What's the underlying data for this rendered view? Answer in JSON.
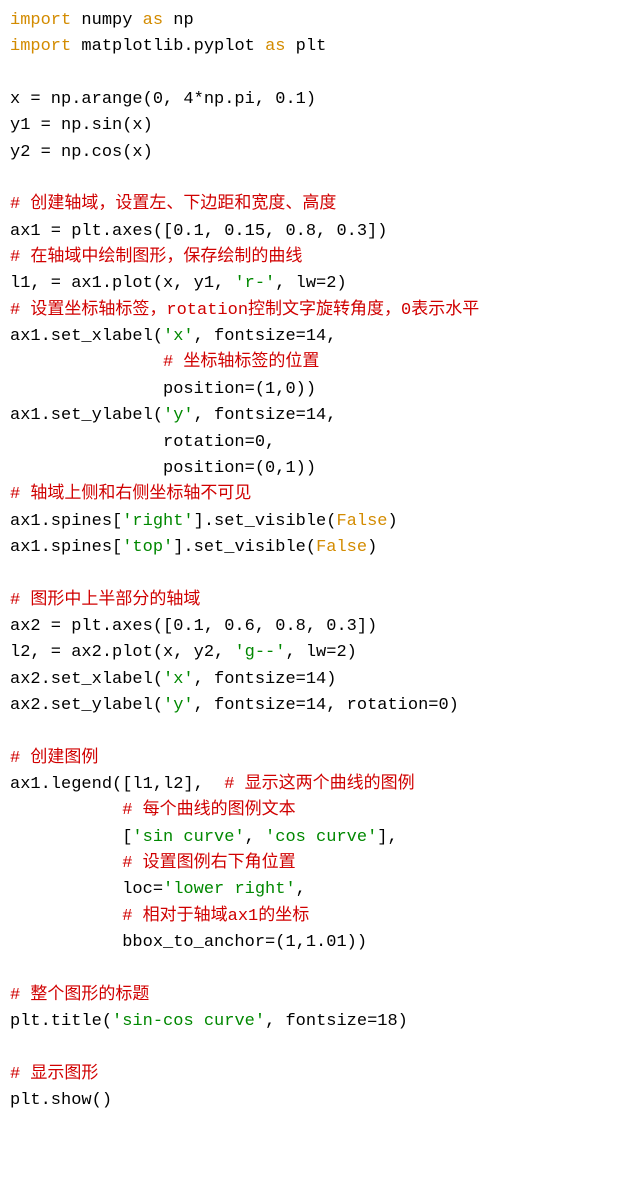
{
  "tokens": [
    {
      "cls": "kw",
      "t": "import"
    },
    {
      "t": " numpy "
    },
    {
      "cls": "kw",
      "t": "as"
    },
    {
      "t": " np\n"
    },
    {
      "cls": "kw",
      "t": "import"
    },
    {
      "t": " matplotlib.pyplot "
    },
    {
      "cls": "kw",
      "t": "as"
    },
    {
      "t": " plt\n"
    },
    {
      "t": "\n"
    },
    {
      "t": "x = np.arange(0, 4*np.pi, 0.1)\n"
    },
    {
      "t": "y1 = np.sin(x)\n"
    },
    {
      "t": "y2 = np.cos(x)\n"
    },
    {
      "t": "\n"
    },
    {
      "cls": "cm",
      "t": "# 创建轴域，设置左、下边距和宽度、高度"
    },
    {
      "t": "\n"
    },
    {
      "t": "ax1 = plt.axes([0.1, 0.15, 0.8, 0.3])\n"
    },
    {
      "cls": "cm",
      "t": "# 在轴域中绘制图形，保存绘制的曲线"
    },
    {
      "t": "\n"
    },
    {
      "t": "l1, = ax1.plot(x, y1, "
    },
    {
      "cls": "st",
      "t": "'r-'"
    },
    {
      "t": ", lw=2)\n"
    },
    {
      "cls": "cm",
      "t": "# 设置坐标轴标签，rotation控制文字旋转角度，0表示水平"
    },
    {
      "t": "\n"
    },
    {
      "t": "ax1.set_xlabel("
    },
    {
      "cls": "st",
      "t": "'x'"
    },
    {
      "t": ", fontsize=14,\n"
    },
    {
      "t": "               "
    },
    {
      "cls": "cm",
      "t": "# 坐标轴标签的位置"
    },
    {
      "t": "\n"
    },
    {
      "t": "               position=(1,0))\n"
    },
    {
      "t": "ax1.set_ylabel("
    },
    {
      "cls": "st",
      "t": "'y'"
    },
    {
      "t": ", fontsize=14,\n"
    },
    {
      "t": "               rotation=0,\n"
    },
    {
      "t": "               position=(0,1))\n"
    },
    {
      "cls": "cm",
      "t": "# 轴域上侧和右侧坐标轴不可见"
    },
    {
      "t": "\n"
    },
    {
      "t": "ax1.spines["
    },
    {
      "cls": "st",
      "t": "'right'"
    },
    {
      "t": "].set_visible("
    },
    {
      "cls": "bl",
      "t": "False"
    },
    {
      "t": ")\n"
    },
    {
      "t": "ax1.spines["
    },
    {
      "cls": "st",
      "t": "'top'"
    },
    {
      "t": "].set_visible("
    },
    {
      "cls": "bl",
      "t": "False"
    },
    {
      "t": ")\n"
    },
    {
      "t": "\n"
    },
    {
      "cls": "cm",
      "t": "# 图形中上半部分的轴域"
    },
    {
      "t": "\n"
    },
    {
      "t": "ax2 = plt.axes([0.1, 0.6, 0.8, 0.3])\n"
    },
    {
      "t": "l2, = ax2.plot(x, y2, "
    },
    {
      "cls": "st",
      "t": "'g--'"
    },
    {
      "t": ", lw=2)\n"
    },
    {
      "t": "ax2.set_xlabel("
    },
    {
      "cls": "st",
      "t": "'x'"
    },
    {
      "t": ", fontsize=14)\n"
    },
    {
      "t": "ax2.set_ylabel("
    },
    {
      "cls": "st",
      "t": "'y'"
    },
    {
      "t": ", fontsize=14, rotation=0)\n"
    },
    {
      "t": "\n"
    },
    {
      "cls": "cm",
      "t": "# 创建图例"
    },
    {
      "t": "\n"
    },
    {
      "t": "ax1.legend([l1,l2],  "
    },
    {
      "cls": "cm",
      "t": "# 显示这两个曲线的图例"
    },
    {
      "t": "\n"
    },
    {
      "t": "           "
    },
    {
      "cls": "cm",
      "t": "# 每个曲线的图例文本"
    },
    {
      "t": "\n"
    },
    {
      "t": "           ["
    },
    {
      "cls": "st",
      "t": "'sin curve'"
    },
    {
      "t": ", "
    },
    {
      "cls": "st",
      "t": "'cos curve'"
    },
    {
      "t": "],\n"
    },
    {
      "t": "           "
    },
    {
      "cls": "cm",
      "t": "# 设置图例右下角位置"
    },
    {
      "t": "\n"
    },
    {
      "t": "           loc="
    },
    {
      "cls": "st",
      "t": "'lower right'"
    },
    {
      "t": ",\n"
    },
    {
      "t": "           "
    },
    {
      "cls": "cm",
      "t": "# 相对于轴域ax1的坐标"
    },
    {
      "t": "\n"
    },
    {
      "t": "           bbox_to_anchor=(1,1.01))\n"
    },
    {
      "t": "\n"
    },
    {
      "cls": "cm",
      "t": "# 整个图形的标题"
    },
    {
      "t": "\n"
    },
    {
      "t": "plt.title("
    },
    {
      "cls": "st",
      "t": "'sin-cos curve'"
    },
    {
      "t": ", fontsize=18)\n"
    },
    {
      "t": "\n"
    },
    {
      "cls": "cm",
      "t": "# 显示图形"
    },
    {
      "t": "\n"
    },
    {
      "t": "plt.show()\n"
    }
  ]
}
